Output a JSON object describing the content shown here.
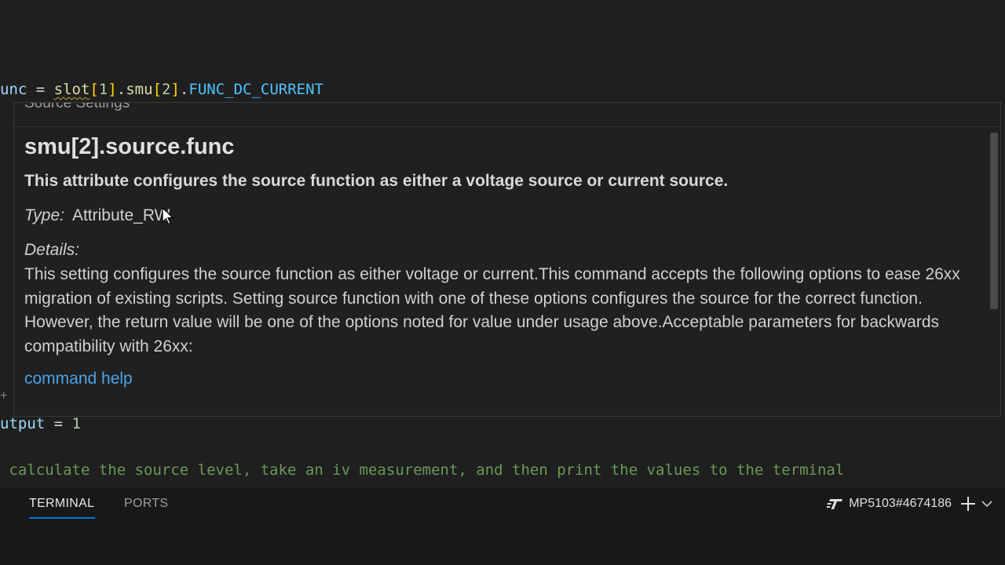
{
  "editor": {
    "line1": {
      "t1": "unc",
      "t2": " = ",
      "t3": "slot",
      "t4": "[",
      "t5": "1",
      "t6": "]",
      "t7": ".",
      "t8": "smu",
      "t9": "[",
      "t10": "2",
      "t11": "]",
      "t12": ".",
      "t13": "FUNC_DC_CURRENT"
    },
    "line2": {
      "t1": "utput",
      "t2": " = ",
      "t3": "1"
    },
    "line3": " calculate the source level, take an iv measurement, and then print the values to the terminal"
  },
  "hover": {
    "header": "Source Settings",
    "title": "smu[2].source.func",
    "summary": "This attribute configures the source function as either a voltage source or current source.",
    "type_label": "Type:",
    "type_value": "Attribute_RW",
    "details_label": "Details:",
    "details": "This setting configures the source function as either voltage or current.This command accepts the following options to ease 26xx migration of existing scripts. Setting source function with one of these options configures the source for the correct function. However, the return value will be one of the options noted for value under usage above.Acceptable parameters for backwards compatibility with 26xx:",
    "link": "command help"
  },
  "panel": {
    "tabs": [
      {
        "label": "TERMINAL",
        "active": true
      },
      {
        "label": "PORTS",
        "active": false
      }
    ],
    "terminal_name": "MP5103#4674186",
    "icons": [
      "terminal-logo-icon",
      "plus-icon",
      "chevron-down-icon"
    ]
  },
  "colors": {
    "link": "#4aa3e8",
    "accent": "#0078d4",
    "comment": "#6a9955",
    "constant": "#4fc1ff",
    "function": "#dcdcaa",
    "bracket": "#ffd700"
  }
}
